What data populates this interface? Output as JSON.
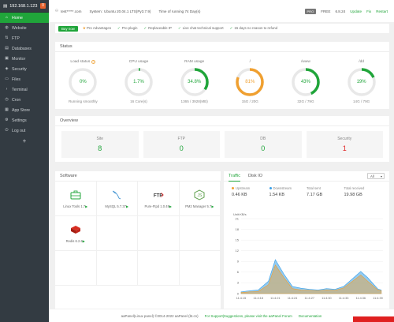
{
  "sidebar": {
    "ip": "192.168.1.123",
    "badge": "0",
    "items": [
      {
        "label": "Home",
        "icon": "home-icon",
        "glyph": "⌂",
        "active": true
      },
      {
        "label": "Website",
        "icon": "globe-icon",
        "glyph": "◍"
      },
      {
        "label": "FTP",
        "icon": "ftp-icon",
        "glyph": "⇅"
      },
      {
        "label": "Databases",
        "icon": "database-icon",
        "glyph": "▤"
      },
      {
        "label": "Monitor",
        "icon": "monitor-icon",
        "glyph": "▣"
      },
      {
        "label": "Security",
        "icon": "shield-icon",
        "glyph": "◈"
      },
      {
        "label": "Files",
        "icon": "folder-icon",
        "glyph": "▭"
      },
      {
        "label": "Terminal",
        "icon": "terminal-icon",
        "glyph": "›"
      },
      {
        "label": "Cron",
        "icon": "clock-icon",
        "glyph": "◷"
      },
      {
        "label": "App Store",
        "icon": "grid-icon",
        "glyph": "▦"
      },
      {
        "label": "Settings",
        "icon": "gear-icon",
        "glyph": "⚙"
      },
      {
        "label": "Log out",
        "icon": "logout-icon",
        "glyph": "⏻"
      }
    ],
    "add_label": "+"
  },
  "topbar": {
    "user": "test*****.com",
    "system_label": "System:",
    "system": "Ubuntu 20.04.1 LTS(Py3.7.9)",
    "uptime": "Time of running 74 Day(s)",
    "pro_pill": "PRO",
    "edition": "FREE",
    "version": "6.8.24",
    "update": "Update",
    "fix": "Fix",
    "restart": "Restart"
  },
  "buybar": {
    "buy_label": "Buy now",
    "adv_label": "Pro Advantages",
    "features": [
      "Pro plugin",
      "Replaceable IP",
      "Live chat technical support",
      "15 days no reason to refund"
    ]
  },
  "status": {
    "title": "Status",
    "gauges": [
      {
        "title": "Load status",
        "value": "0%",
        "pct": 0,
        "sub": "Running smoothly",
        "color": "#20a53a",
        "help": "?"
      },
      {
        "title": "CPU usage",
        "value": "1.7%",
        "pct": 1.7,
        "sub": "16 Core(s)",
        "color": "#20a53a"
      },
      {
        "title": "RAM usage",
        "value": "34.8%",
        "pct": 34.8,
        "sub": "1365 / 3928(MB)",
        "color": "#20a53a"
      },
      {
        "title": "/",
        "value": "81%",
        "pct": 81,
        "sub": "15G / 20G",
        "color": "#f0a030"
      },
      {
        "title": "/www",
        "value": "43%",
        "pct": 43,
        "sub": "32G / 79G",
        "color": "#20a53a"
      },
      {
        "title": "/dd",
        "value": "19%",
        "pct": 19,
        "sub": "14G / 79G",
        "color": "#20a53a"
      }
    ]
  },
  "overview": {
    "title": "Overview",
    "cards": [
      {
        "label": "Site",
        "value": "8",
        "color": "#20a53a"
      },
      {
        "label": "FTP",
        "value": "0",
        "color": "#20a53a"
      },
      {
        "label": "DB",
        "value": "0",
        "color": "#20a53a"
      },
      {
        "label": "Security",
        "value": "1",
        "color": "#e02020"
      }
    ]
  },
  "software": {
    "title": "Software",
    "items": [
      {
        "label": "Linux Tools 1.7",
        "icon": "toolbox-icon"
      },
      {
        "label": "MySQL 5.7.37",
        "icon": "mysql-dolphin-icon"
      },
      {
        "label": "Pure-Ftpd 1.0.49",
        "icon": "ftp-logo-icon"
      },
      {
        "label": "PM2 Manager 5.7",
        "icon": "nodejs-icon"
      },
      {
        "label": "Redis 6.2.6",
        "icon": "redis-icon"
      }
    ],
    "play": "▶"
  },
  "traffic": {
    "tabs": [
      "Traffic",
      "Disk IO"
    ],
    "select": "All",
    "stats": [
      {
        "label": "Upstream",
        "value": "0.46 KB",
        "dot": "#f0a030"
      },
      {
        "label": "Downstream",
        "value": "1.54 KB",
        "dot": "#3aa0e8"
      },
      {
        "label": "Total sent",
        "value": "7.17 GB"
      },
      {
        "label": "Total received",
        "value": "19.98 GB"
      }
    ]
  },
  "chart_data": {
    "type": "area",
    "ylabel": "Unit:KB/s",
    "ylim": [
      0,
      21
    ],
    "yticks": [
      0,
      3,
      6,
      9,
      12,
      15,
      18,
      21
    ],
    "categories": [
      "11:4:15",
      "11:4:18",
      "11:4:21",
      "11:4:24",
      "11:4:27",
      "11:4:30",
      "11:4:33",
      "11:4:36",
      "11:4:39"
    ],
    "x": [
      0,
      1,
      2,
      3,
      4,
      5,
      6,
      7,
      8
    ],
    "series": [
      {
        "name": "Downstream",
        "color": "#3aa0e8",
        "values": [
          0.5,
          0.8,
          1.0,
          3.5,
          9.5,
          5.5,
          2.0,
          1.5,
          1.2,
          1.0,
          1.4,
          1.2,
          2.0,
          6.2,
          4.5,
          1.3,
          1.0
        ],
        "x": [
          0,
          0.5,
          1,
          1.6,
          2.0,
          2.5,
          3,
          3.5,
          4,
          4.5,
          5,
          5.5,
          6,
          7,
          7.4,
          8,
          8.2
        ]
      },
      {
        "name": "Upstream",
        "color": "#f0a030",
        "values": [
          0.3,
          0.5,
          0.6,
          2.5,
          8.0,
          4.5,
          1.4,
          1.0,
          0.9,
          0.8,
          1.0,
          0.9,
          1.6,
          5.2,
          3.5,
          1.0,
          0.8
        ],
        "x": [
          0,
          0.5,
          1,
          1.6,
          2.0,
          2.5,
          3,
          3.5,
          4,
          4.5,
          5,
          5.5,
          6,
          7,
          7.4,
          8,
          8.2
        ]
      }
    ]
  },
  "footer": {
    "copyright": "aaPanel(Linux panel) ©2014-2022 aaPanel (bt.cn)",
    "support": "For Support|Suggestions, please visit the aaPanel Forum",
    "docs": "Documentation"
  },
  "colors": {
    "accent": "#20a53a",
    "sidebar": "#333b42",
    "warn": "#f0a030",
    "danger": "#e02020"
  }
}
